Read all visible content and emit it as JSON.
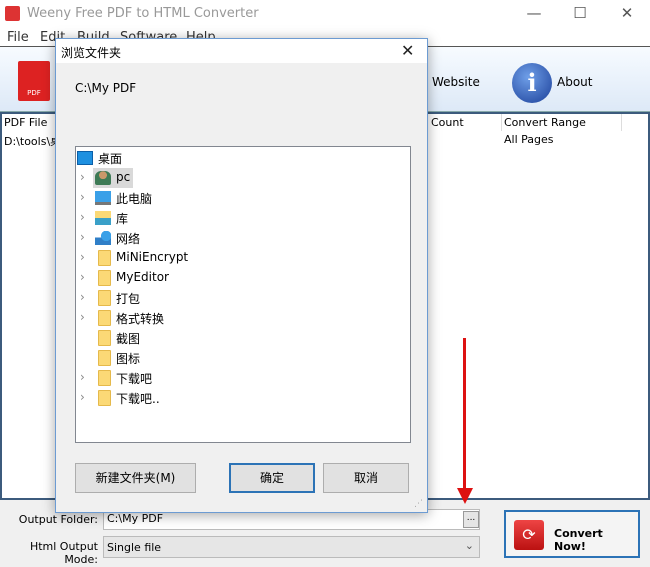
{
  "window": {
    "title": "Weeny Free PDF to HTML Converter",
    "minimize": "—",
    "maximize": "☐",
    "close": "✕"
  },
  "menu": [
    "File",
    "Edit",
    "Build",
    "Software",
    "Help"
  ],
  "toolbar": {
    "website": "Website",
    "about": "About",
    "pdf_icon_text": "PDF",
    "info_icon_text": "i"
  },
  "list": {
    "columns": [
      "PDF File",
      "Count",
      "Convert Range"
    ],
    "rows": [
      {
        "file": "D:\\tools\\桌",
        "range": "All Pages"
      }
    ]
  },
  "bottom": {
    "output_folder_label": "Output Folder:",
    "output_folder_value": "C:\\My PDF",
    "browse_label": "...",
    "mode_label": "Html Output Mode:",
    "mode_value": "Single file",
    "convert_label": "Convert Now!"
  },
  "dialog": {
    "title": "浏览文件夹",
    "close": "✕",
    "path": "C:\\My PDF",
    "tree": [
      {
        "label": "桌面",
        "icon": "desktop-icon",
        "expand": false,
        "level": 0
      },
      {
        "label": "pc",
        "icon": "user-icon",
        "expand": true,
        "selected": true
      },
      {
        "label": "此电脑",
        "icon": "computer-icon",
        "expand": true
      },
      {
        "label": "库",
        "icon": "library-icon",
        "expand": true
      },
      {
        "label": "网络",
        "icon": "network-icon",
        "expand": true
      },
      {
        "label": "MiNiEncrypt",
        "icon": "folder-icon",
        "expand": true
      },
      {
        "label": "MyEditor",
        "icon": "folder-icon",
        "expand": true
      },
      {
        "label": "打包",
        "icon": "folder-icon",
        "expand": true
      },
      {
        "label": "格式转换",
        "icon": "folder-icon",
        "expand": true
      },
      {
        "label": "截图",
        "icon": "folder-icon",
        "expand": false
      },
      {
        "label": "图标",
        "icon": "folder-icon",
        "expand": false
      },
      {
        "label": "下载吧",
        "icon": "folder-icon",
        "expand": true
      },
      {
        "label": "下载吧..",
        "icon": "folder-icon",
        "expand": true
      }
    ],
    "new_folder": "新建文件夹(M)",
    "ok": "确定",
    "cancel": "取消"
  },
  "colors": {
    "accent": "#2c73b6",
    "arrow": "#dd1111"
  }
}
